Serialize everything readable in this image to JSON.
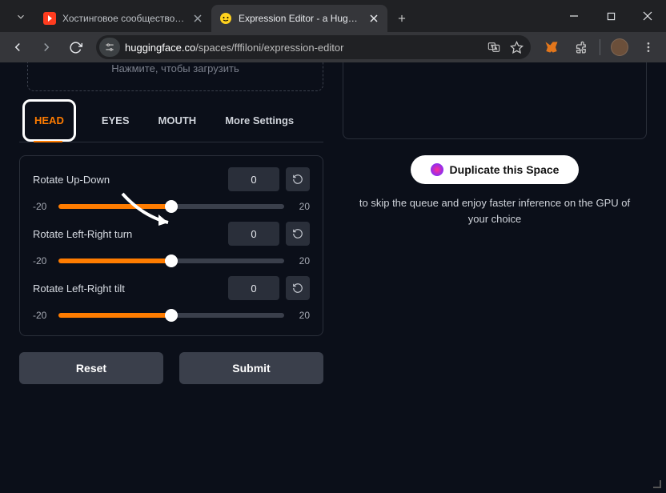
{
  "browser": {
    "tabs": [
      {
        "title": "Хостинговое сообщество «Tim",
        "active": false
      },
      {
        "title": "Expression Editor - a Hugging F",
        "active": true
      }
    ],
    "url_host": "huggingface.co",
    "url_path": "/spaces/fffiloni/expression-editor"
  },
  "upload_hint": "Нажмите, чтобы загрузить",
  "tabs": {
    "head": "HEAD",
    "eyes": "EYES",
    "mouth": "MOUTH",
    "more": "More Settings"
  },
  "controls": [
    {
      "label": "Rotate Up-Down",
      "value": "0",
      "min": "-20",
      "max": "20",
      "pct": 50
    },
    {
      "label": "Rotate Left-Right turn",
      "value": "0",
      "min": "-20",
      "max": "20",
      "pct": 50
    },
    {
      "label": "Rotate Left-Right tilt",
      "value": "0",
      "min": "-20",
      "max": "20",
      "pct": 50
    }
  ],
  "buttons": {
    "reset": "Reset",
    "submit": "Submit"
  },
  "duplicate": {
    "label": "Duplicate this Space",
    "caption1": "to skip the queue and enjoy faster inference on the GPU of",
    "caption2": "your choice"
  }
}
